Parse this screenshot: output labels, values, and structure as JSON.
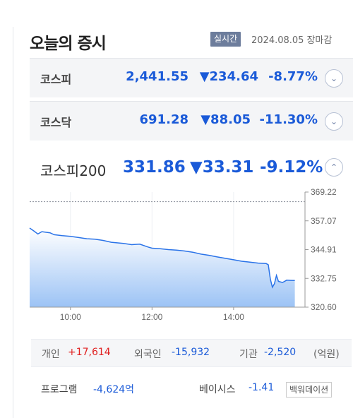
{
  "header": {
    "title": "오늘의 증시",
    "badge": "실시간",
    "date": "2024.08.05",
    "status": "장마감"
  },
  "indices": [
    {
      "name": "코스피",
      "value": "2,441.55",
      "change": "▼234.64",
      "rate": "-8.77%"
    },
    {
      "name": "코스닥",
      "value": "691.28",
      "change": "▼88.05",
      "rate": "-11.30%"
    }
  ],
  "detail": {
    "name": "코스피200",
    "value": "331.86",
    "change": "▼33.31",
    "rate": "-9.12%"
  },
  "colors": {
    "down": "#1a5ad8",
    "up": "#e02020",
    "line": "#2a73e8",
    "badge": "#6d7d9c"
  },
  "chart_data": {
    "type": "area",
    "x_ticks": [
      "10:00",
      "12:00",
      "14:00"
    ],
    "y_ticks": [
      "369.22",
      "357.07",
      "344.91",
      "332.75",
      "320.60"
    ],
    "ylim": [
      320.6,
      369.22
    ],
    "previous_close": 365.17,
    "x_hours": [
      9.0,
      9.1,
      9.2,
      9.3,
      9.5,
      9.6,
      9.8,
      10.0,
      10.2,
      10.4,
      10.6,
      10.8,
      11.0,
      11.3,
      11.5,
      11.7,
      11.9,
      12.0,
      12.2,
      12.4,
      12.6,
      12.8,
      13.0,
      13.2,
      13.4,
      13.6,
      13.8,
      14.0,
      14.2,
      14.4,
      14.6,
      14.8,
      14.85,
      14.9,
      14.95,
      15.0,
      15.05,
      15.1,
      15.2,
      15.3,
      15.4,
      15.5
    ],
    "values": [
      354.0,
      352.8,
      351.5,
      352.5,
      352.0,
      351.2,
      350.8,
      350.5,
      350.0,
      349.5,
      349.3,
      348.8,
      348.0,
      347.5,
      347.0,
      347.2,
      346.0,
      345.5,
      345.3,
      344.9,
      344.7,
      344.3,
      343.8,
      343.0,
      342.5,
      341.8,
      341.2,
      340.6,
      340.0,
      339.6,
      339.2,
      339.0,
      338.5,
      332.5,
      329.0,
      330.5,
      334.0,
      331.5,
      331.0,
      332.0,
      331.9,
      331.86
    ]
  },
  "investors": {
    "individual_label": "개인",
    "individual_value": "+17,614",
    "foreign_label": "외국인",
    "foreign_value": "-15,932",
    "institution_label": "기관",
    "institution_value": "-2,520",
    "unit": "(억원)"
  },
  "program": {
    "label": "프로그램",
    "value": "-4,624억",
    "basis_label": "베이시스",
    "basis_value": "-1.41",
    "basis_unit": "백워데이션"
  }
}
